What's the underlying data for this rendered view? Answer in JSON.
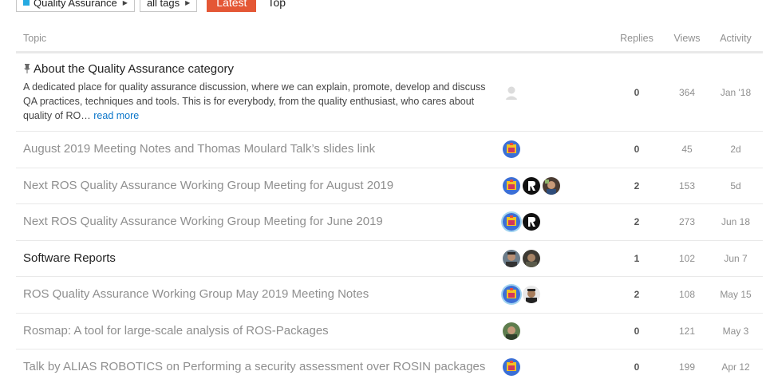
{
  "nav": {
    "category_label": "Quality Assurance",
    "tags_label": "all tags",
    "latest_label": "Latest",
    "top_label": "Top"
  },
  "table": {
    "headers": {
      "topic": "Topic",
      "replies": "Replies",
      "views": "Views",
      "activity": "Activity"
    },
    "featured": {
      "title": "About the Quality Assurance category",
      "excerpt": "A dedicated place for quality assurance discussion, where we can explain, promote, develop and discuss QA practices, techniques and tools. This is for everybody, from the quality enthusiast, who cares about quality of RO…",
      "read_more": "read more",
      "replies": "0",
      "views": "364",
      "activity": "Jan '18"
    },
    "rows": [
      {
        "title": "August 2019 Meeting Notes and Thomas Moulard Talk’s slides link",
        "replies": "0",
        "views": "45",
        "activity": "2d"
      },
      {
        "title": "Next ROS Quality Assurance Working Group Meeting for August 2019",
        "replies": "2",
        "views": "153",
        "activity": "5d"
      },
      {
        "title": "Next ROS Quality Assurance Working Group Meeting for June 2019",
        "replies": "2",
        "views": "273",
        "activity": "Jun 18"
      },
      {
        "title": "Software Reports",
        "replies": "1",
        "views": "102",
        "activity": "Jun 7"
      },
      {
        "title": "ROS Quality Assurance Working Group May 2019 Meeting Notes",
        "replies": "2",
        "views": "108",
        "activity": "May 15"
      },
      {
        "title": "Rosmap: A tool for large-scale analysis of ROS-Packages",
        "replies": "0",
        "views": "121",
        "activity": "May 3"
      },
      {
        "title": "Talk by ALIAS ROBOTICS on Performing a security assessment over ROSIN packages",
        "replies": "0",
        "views": "199",
        "activity": "Apr 12"
      }
    ]
  },
  "colors": {
    "accent": "#e45735",
    "category": "#25aae1",
    "link": "#0a75c9",
    "read_title": "#8f8f8f"
  },
  "icons": [
    "caret-right-icon",
    "pin-icon"
  ]
}
